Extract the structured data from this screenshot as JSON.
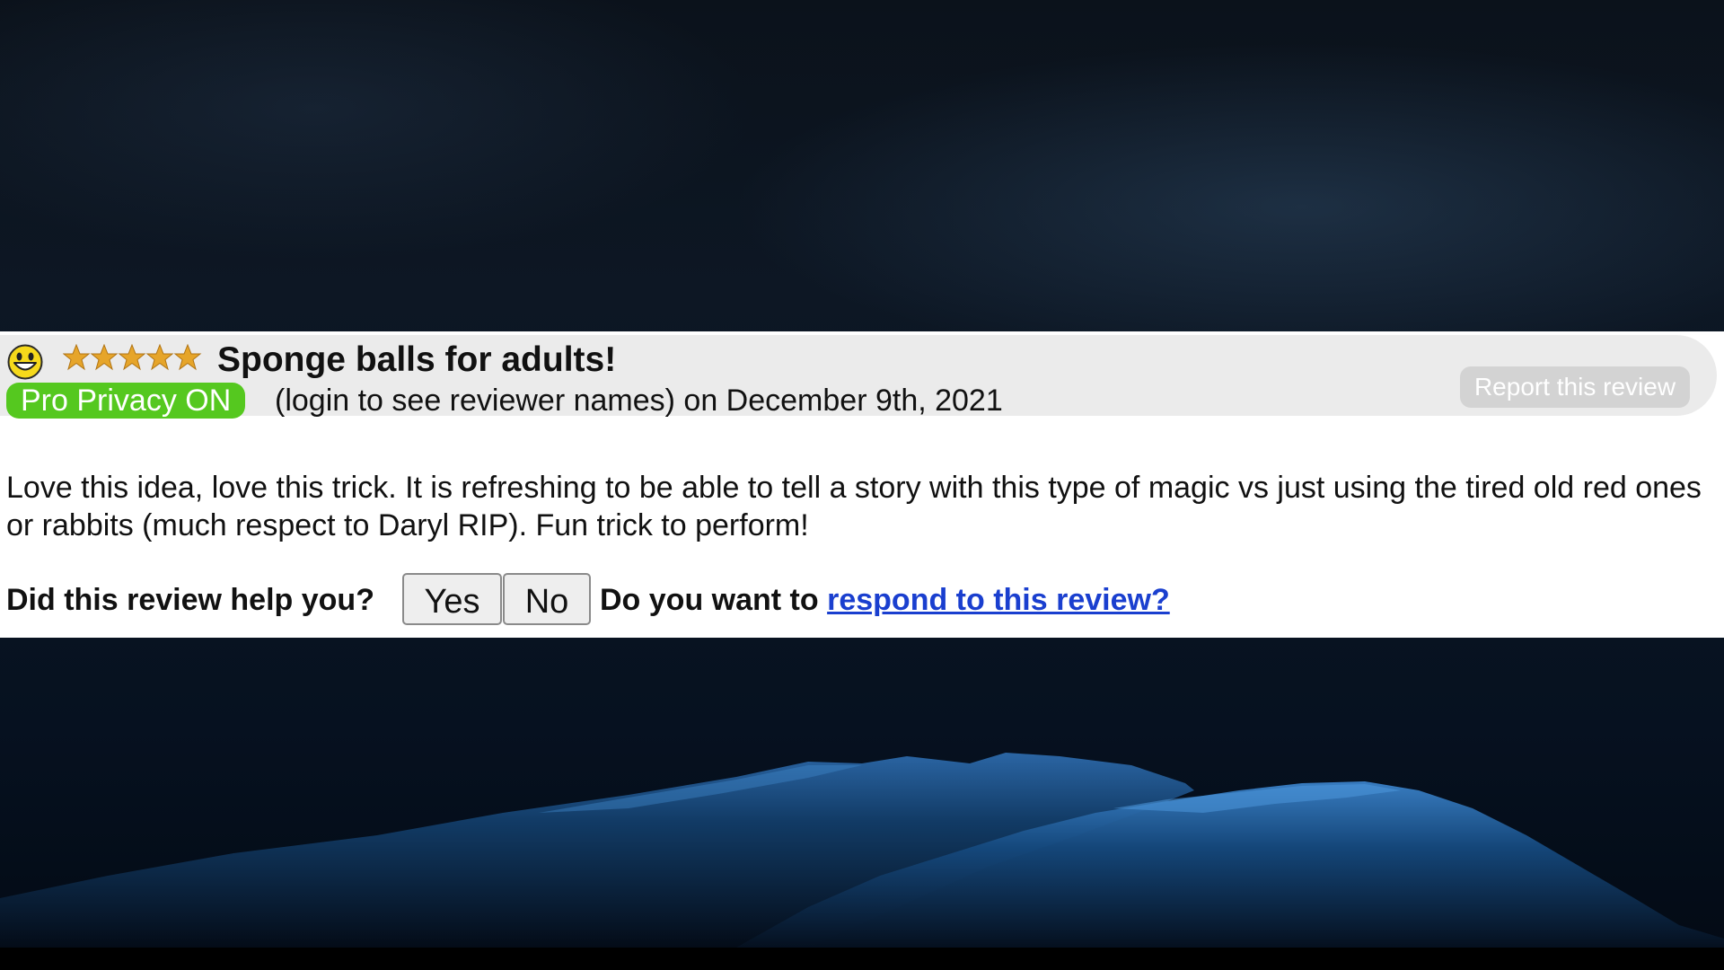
{
  "review": {
    "rating_stars": 5,
    "title": "Sponge balls for adults!",
    "privacy_badge": "Pro Privacy ON",
    "reviewer_line": "(login to see reviewer names) on December 9th, 2021",
    "report_label": "Report this review",
    "body": "Love this idea, love this trick. It is refreshing to be able to tell a story with this type of magic vs just using the tired old red ones or rabbits (much respect to Daryl RIP). Fun trick to perform!"
  },
  "helpful": {
    "question": "Did this review help you?",
    "yes_label": "Yes",
    "no_label": "No",
    "respond_prefix": "Do you want to",
    "respond_link": "respond to this review?"
  },
  "colors": {
    "badge_green": "#55c81f",
    "link_blue": "#1a3fcf",
    "star_gold": "#e6a52a",
    "header_gray": "#ebebeb"
  },
  "icons": {
    "smiley": "smiley-face-icon",
    "star": "star-icon"
  }
}
